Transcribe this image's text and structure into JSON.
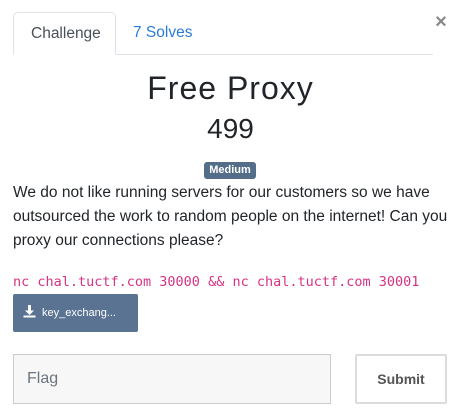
{
  "tabs": [
    {
      "label": "Challenge",
      "active": true
    },
    {
      "label": "7 Solves",
      "active": false
    }
  ],
  "close_glyph": "×",
  "challenge": {
    "name": "Free Proxy",
    "points": "499",
    "difficulty": "Medium",
    "description": "We do not like running servers for our customers so we have outsourced the work to random people on the internet! Can you proxy our connections please?",
    "command": "nc chal.tuctf.com 30000 && nc chal.tuctf.com 30001"
  },
  "file": {
    "label": "key_exchang...",
    "icon": "download-icon"
  },
  "form": {
    "flag_placeholder": "Flag",
    "submit_label": "Submit"
  },
  "colors": {
    "link": "#2a7bd7",
    "badge": "#546e8a",
    "file_button": "#5a7392",
    "command": "#d63384"
  }
}
